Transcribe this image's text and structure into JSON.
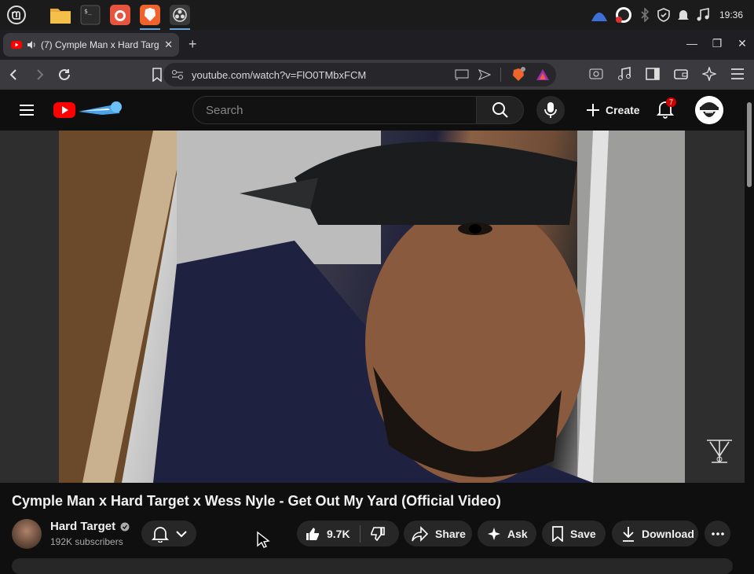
{
  "taskbar": {
    "apps": [
      "mint-menu-icon",
      "files-icon",
      "terminal-icon",
      "firefox-icon",
      "brave-icon",
      "obs-icon"
    ],
    "clock": "19:36"
  },
  "browser": {
    "tab": {
      "title": "(7) Cymple Man x Hard Targ",
      "audio": true
    },
    "url": "youtube.com/watch?v=FlO0TMbxFCM"
  },
  "youtube": {
    "search_placeholder": "Search",
    "create_label": "Create",
    "notification_count": "7"
  },
  "video": {
    "title": "Cymple Man x Hard Target x Wess Nyle - Get Out My Yard (Official Video)",
    "channel": "Hard Target",
    "subscribers": "192K subscribers",
    "likes": "9.7K",
    "share_label": "Share",
    "ask_label": "Ask",
    "save_label": "Save",
    "download_label": "Download"
  },
  "colors": {
    "accent": "#ff0000",
    "badge": "#cc0000",
    "background": "#0f0f0f",
    "pill": "#272727"
  }
}
